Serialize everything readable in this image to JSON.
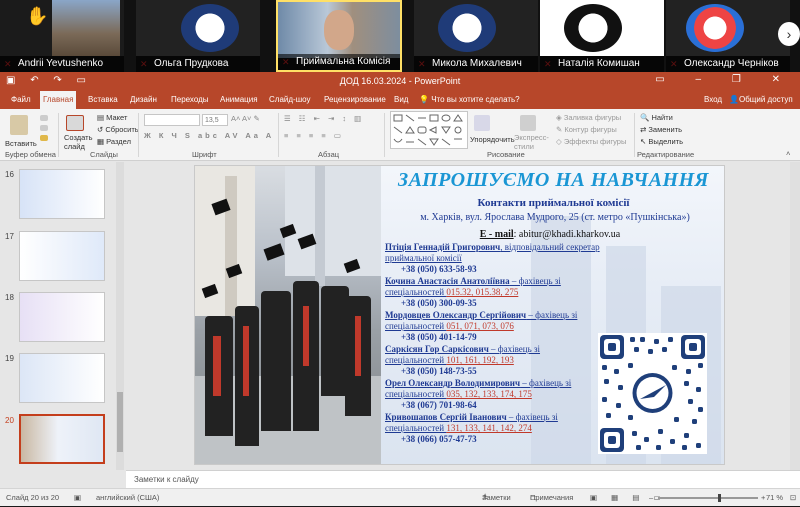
{
  "participants": [
    {
      "name": "Andrii Yevtushenko",
      "hand_raised": true
    },
    {
      "name": "Ольга Прудкова"
    },
    {
      "name": "Приймальна Комісія"
    },
    {
      "name": "Микола Михалевич"
    },
    {
      "name": "Наталія Комишан"
    },
    {
      "name": "Олександр Черніков"
    }
  ],
  "window": {
    "title": "ДОД 16.03.2024 - PowerPoint"
  },
  "tabs": [
    "Файл",
    "Главная",
    "Вставка",
    "Дизайн",
    "Переходы",
    "Анимация",
    "Слайд-шоу",
    "Рецензирование",
    "Вид"
  ],
  "active_tab": "Главная",
  "tell_me": "Что вы хотите сделать?",
  "sign_in": "Вход",
  "share": "Общий доступ",
  "ribbon": {
    "paste": "Вставить",
    "create_slide": "Создать слайд",
    "layout": "Макет",
    "reset": "Сбросить",
    "section": "Раздел",
    "font_size": "13,5",
    "arrange": "Упорядочить",
    "quick_styles": "Экспресс-стили",
    "shape_fill": "Заливка фигуры",
    "shape_outline": "Контур фигуры",
    "shape_effects": "Эффекты фигуры",
    "find": "Найти",
    "replace": "Заменить",
    "select": "Выделить",
    "groups": {
      "clipboard": "Буфер обмена",
      "slides": "Слайды",
      "font": "Шрифт",
      "paragraph": "Абзац",
      "drawing": "Рисование",
      "editing": "Редактирование"
    }
  },
  "thumbnails": [
    {
      "num": "16",
      "selected": false
    },
    {
      "num": "17",
      "selected": false
    },
    {
      "num": "18",
      "selected": false
    },
    {
      "num": "19",
      "selected": false
    },
    {
      "num": "20",
      "selected": true
    }
  ],
  "slide": {
    "title": "ЗАПРОШУЄМО НА НАВЧАННЯ",
    "subtitle": "Контакти приймальної комісії",
    "address": "м. Харків, вул. Ярослава Мудрого, 25 (ст. метро «Пушкінська»)",
    "email_label": "E - mail",
    "email": ": abitur@khadi.kharkov.ua",
    "contacts": [
      {
        "name": "Птіція Геннадій Григорович",
        "role": ", відповідальний секретар приймальної комісії",
        "spec": "",
        "phone": "+38 (050) 633-58-93"
      },
      {
        "name": "Кочина Анастасія Анатоліївна",
        "role": " – фахівець зі спеціальностей ",
        "spec": "015.32, 015.38, 275",
        "phone": "+38 (050) 300-09-35"
      },
      {
        "name": "Мордовцев Олександр Сергійович",
        "role": " – фахівець зі спеціальностей ",
        "spec": "051, 071, 073, 076",
        "phone": "+38 (050) 401-14-79"
      },
      {
        "name": "Саркісян Гор Саркісович",
        "role": " – фахівець зі спеціальностей ",
        "spec": "101, 161, 192, 193",
        "phone": "+38 (050) 148-73-55"
      },
      {
        "name": "Орел Олександр Володимирович",
        "role": " – фахівець зі спеціальностей ",
        "spec": "035, 132, 133, 174, 175",
        "phone": "+38 (067) 701-98-64"
      },
      {
        "name": "Кривошапов Сергій Іванович",
        "role": " – фахівець зі спеціальностей ",
        "spec": "131, 133, 141, 142, 274",
        "phone": "+38 (066) 057-47-73"
      }
    ]
  },
  "notes_placeholder": "Заметки к слайду",
  "status": {
    "slide_counter": "Слайд 20 из 20",
    "language": "английский (США)",
    "notes": "Заметки",
    "comments": "Примечания",
    "zoom": "71 %"
  },
  "colors": {
    "ppt_accent": "#b7472a",
    "title_blue": "#1a96d4",
    "text_navy": "#1f3a93",
    "spec_red": "#c0392b"
  }
}
